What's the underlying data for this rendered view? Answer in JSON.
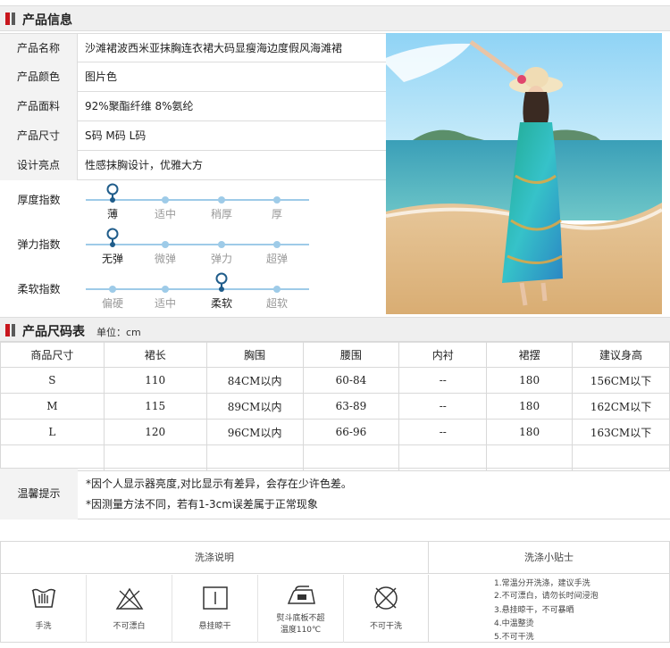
{
  "section1": {
    "title": "产品信息"
  },
  "info": [
    {
      "label": "产品名称",
      "value": "沙滩裙波西米亚抹胸连衣裙大码显瘦海边度假风海滩裙"
    },
    {
      "label": "产品颜色",
      "value": "图片色"
    },
    {
      "label": "产品面料",
      "value": "92%聚酯纤维 8%氨纶"
    },
    {
      "label": "产品尺寸",
      "value": "S码  M码  L码"
    },
    {
      "label": "设计亮点",
      "value": "性感抹胸设计，优雅大方"
    }
  ],
  "indices": [
    {
      "label": "厚度指数",
      "options": [
        "薄",
        "适中",
        "稍厚",
        "厚"
      ],
      "selected": 0
    },
    {
      "label": "弹力指数",
      "options": [
        "无弹",
        "微弹",
        "弹力",
        "超弹"
      ],
      "selected": 0
    },
    {
      "label": "柔软指数",
      "options": [
        "偏硬",
        "适中",
        "柔软",
        "超软"
      ],
      "selected": 2
    }
  ],
  "section2": {
    "title": "产品尺码表",
    "unit": "单位：cm"
  },
  "size_table": {
    "headers": [
      "商品尺寸",
      "裙长",
      "胸围",
      "腰围",
      "内衬",
      "裙摆",
      "建议身高"
    ],
    "rows": [
      [
        "S",
        "110",
        "84CM以内",
        "60-84",
        "--",
        "180",
        "156CM以下"
      ],
      [
        "M",
        "115",
        "89CM以内",
        "63-89",
        "--",
        "180",
        "162CM以下"
      ],
      [
        "L",
        "120",
        "96CM以内",
        "66-96",
        "--",
        "180",
        "163CM以下"
      ]
    ]
  },
  "tips": {
    "label": "温馨提示",
    "lines": [
      "*因个人显示器亮度,对比显示有差异，会存在少许色差。",
      "*因测量方法不同，若有1-3cm误差属于正常现象"
    ]
  },
  "wash": {
    "header_left": "洗涤说明",
    "header_right": "洗涤小贴士",
    "icons": [
      {
        "icon": "hand-wash-icon",
        "label": "手洗"
      },
      {
        "icon": "no-bleach-icon",
        "label": "不可漂白"
      },
      {
        "icon": "hang-dry-icon",
        "label": "悬挂晾干"
      },
      {
        "icon": "iron-icon",
        "label": "熨斗底板不超\n温度110℃"
      },
      {
        "icon": "no-dry-clean-icon",
        "label": "不可干洗"
      }
    ],
    "tips": [
      "1.常温分开洗涤，建议手洗",
      "2.不可漂白，请勿长时间浸泡",
      "3.悬挂晾干，不可暴晒",
      "4.中温整烫",
      "5.不可干洗"
    ]
  }
}
